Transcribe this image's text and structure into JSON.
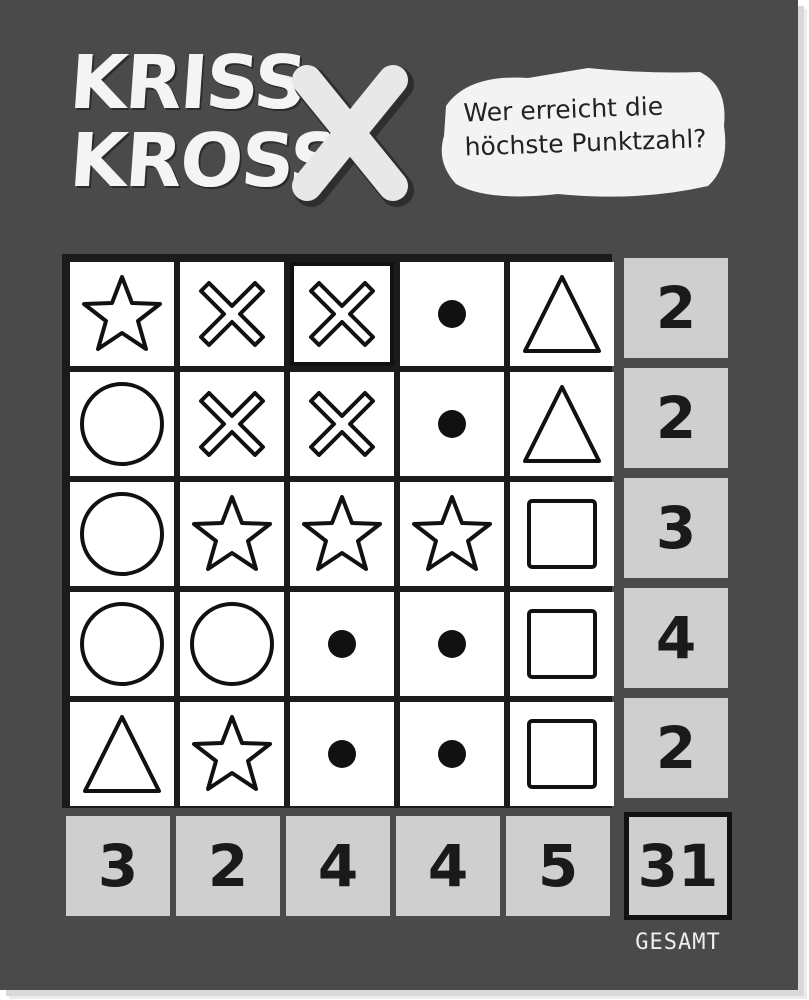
{
  "title": {
    "line1": "KRISS",
    "line2": "KROSS",
    "mark": "X"
  },
  "slogan": {
    "line1": "Wer erreicht die",
    "line2": "höchste Punktzahl?"
  },
  "grid": {
    "rows": [
      [
        "star",
        "cross",
        "cross",
        "dot",
        "triangle"
      ],
      [
        "circle",
        "cross",
        "cross",
        "dot",
        "triangle"
      ],
      [
        "circle",
        "star",
        "star",
        "star",
        "square"
      ],
      [
        "circle",
        "circle",
        "dot",
        "dot",
        "square"
      ],
      [
        "triangle",
        "star",
        "dot",
        "dot",
        "square"
      ]
    ],
    "highlighted_cell": {
      "row": 0,
      "col": 2
    }
  },
  "row_scores": [
    "2",
    "2",
    "3",
    "4",
    "2"
  ],
  "column_scores": [
    "3",
    "2",
    "4",
    "4",
    "5"
  ],
  "total": {
    "value": "31",
    "label": "GESAMT"
  },
  "colors": {
    "background": "#4a4a4a",
    "cell": "#ffffff",
    "score_box": "#cfcfcf",
    "ink": "#111111"
  }
}
